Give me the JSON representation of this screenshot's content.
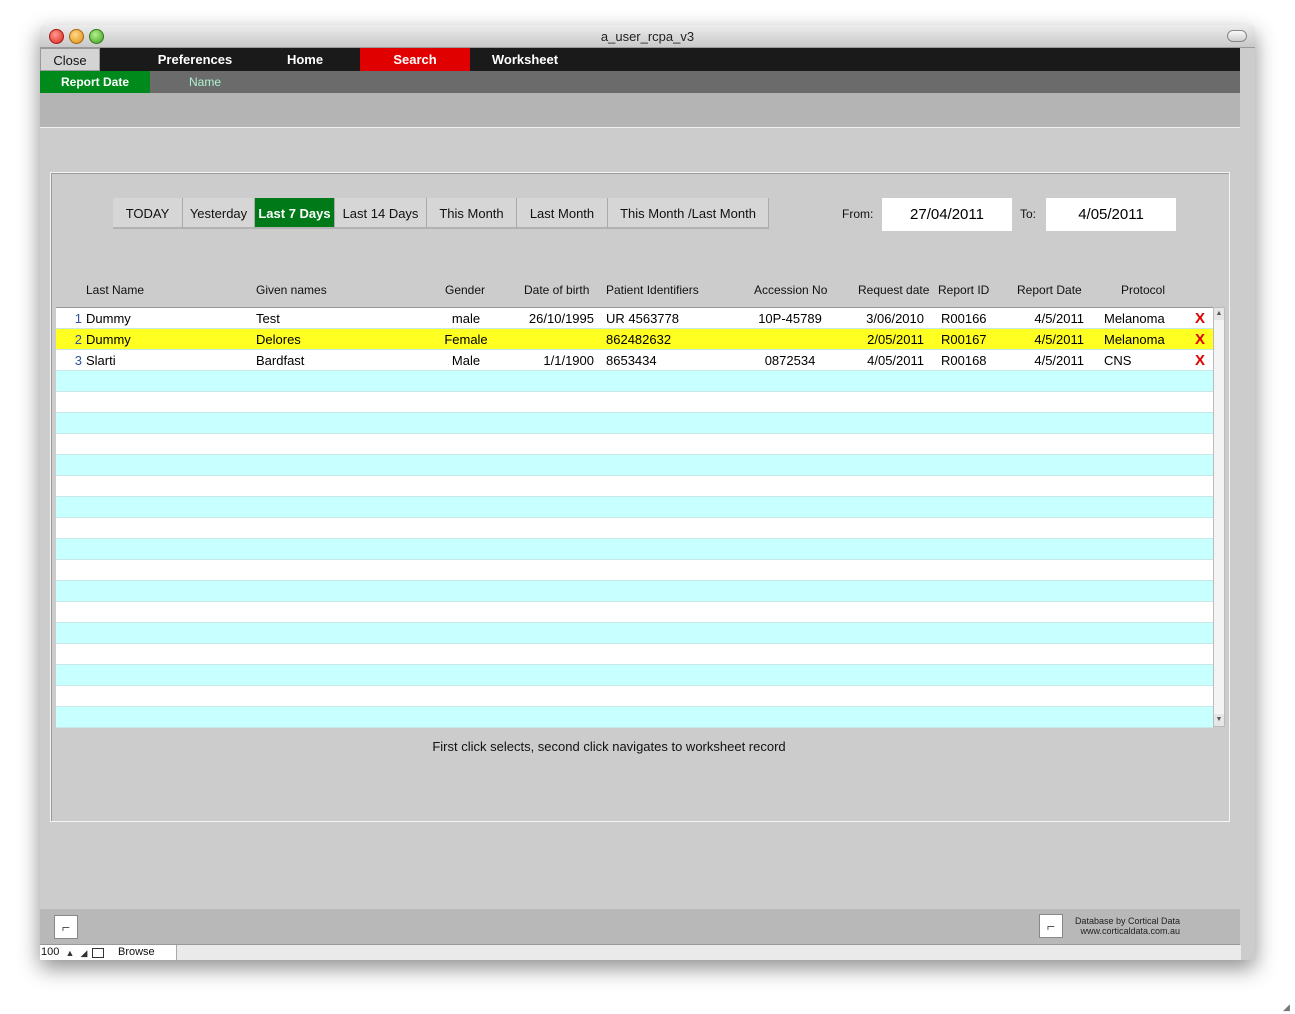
{
  "window": {
    "title": "a_user_rcpa_v3"
  },
  "menu": {
    "close": "Close",
    "items": [
      "Preferences",
      "Home",
      "Search",
      "Worksheet"
    ],
    "active": "Search"
  },
  "subnav": {
    "items": [
      "Report Date",
      "Name"
    ],
    "active": "Report Date"
  },
  "filters": {
    "ranges": [
      "TODAY",
      "Yesterday",
      "Last 7 Days",
      "Last 14 Days",
      "This Month",
      "Last Month",
      "This Month /Last Month"
    ],
    "active": "Last 7 Days",
    "from_label": "From:",
    "from_value": "27/04/2011",
    "to_label": "To:",
    "to_value": "4/05/2011"
  },
  "table": {
    "columns": [
      "Last Name",
      "Given names",
      "Gender",
      "Date of birth",
      "Patient Identifiers",
      "Accession No",
      "Request date",
      "Report ID",
      "Report Date",
      "Protocol"
    ],
    "rows": [
      {
        "num": "1",
        "last": "Dummy",
        "given": "Test",
        "gender": "male",
        "dob": "26/10/1995",
        "pid": "UR 4563778",
        "acc": "10P-45789",
        "req": "3/06/2010",
        "rid": "R00166",
        "rdate": "4/5/2011",
        "protocol": "Melanoma",
        "del": "X"
      },
      {
        "num": "2",
        "last": "Dummy",
        "given": "Delores",
        "gender": "Female",
        "dob": "",
        "pid": "862482632",
        "acc": "",
        "req": "2/05/2011",
        "rid": "R00167",
        "rdate": "4/5/2011",
        "protocol": "Melanoma",
        "del": "X"
      },
      {
        "num": "3",
        "last": "Slarti",
        "given": "Bardfast",
        "gender": "Male",
        "dob": "1/1/1900",
        "pid": "8653434",
        "acc": "0872534",
        "req": "4/05/2011",
        "rid": "R00168",
        "rdate": "4/5/2011",
        "protocol": "CNS",
        "del": "X"
      }
    ],
    "selected_row": 2,
    "hint": "First click selects, second click navigates to worksheet record"
  },
  "footer": {
    "credit_line1": "Database by Cortical Data",
    "credit_line2": "www.corticaldata.com.au"
  },
  "status": {
    "zoom": "100",
    "mode": "Browse"
  },
  "colors": {
    "menu_active": "#e00000",
    "subnav_active": "#008a1c",
    "filter_active": "#007a18",
    "selected_row": "#ffff22",
    "alt_row": "#c8ffff"
  },
  "icons": [
    "close-icon",
    "minimize-icon",
    "maximize-icon",
    "delete-x-icon",
    "logo-icon",
    "zoom-out-icon",
    "zoom-in-icon",
    "layout-icon"
  ]
}
